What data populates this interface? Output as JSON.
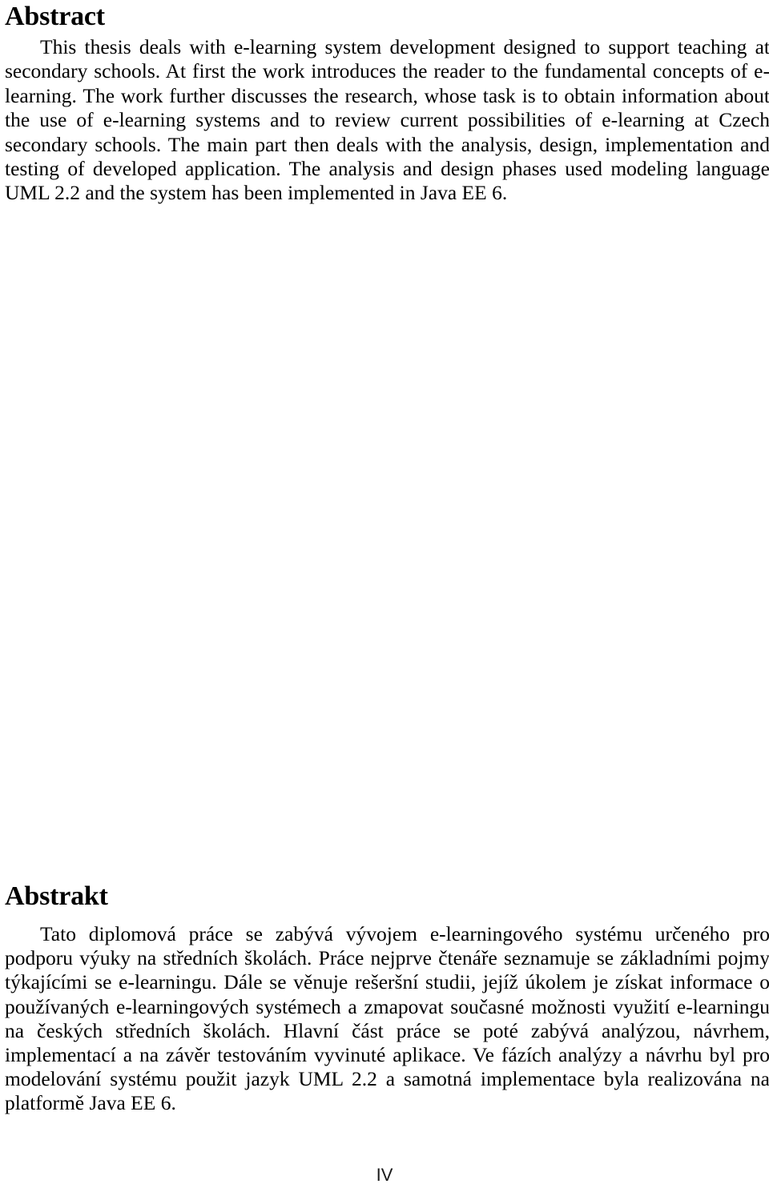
{
  "document": {
    "type": "thesis-abstract-page",
    "page_number": "IV",
    "background_color": "#ffffff",
    "text_color": "#000000"
  },
  "sections": {
    "abstract_en": {
      "heading": "Abstract",
      "body": "This thesis deals with e-learning system development designed to support teaching at secondary schools. At first the work introduces the reader to the fundamental concepts of e-learning. The work further discusses the research, whose task is to obtain information about the use of e-learning systems and to review current possibilities of e-learning at Czech secondary schools. The main part then deals with the analysis, design, implementation and testing of developed application. The analysis and design phases used modeling language UML 2.2 and the system has been implemented in Java EE 6."
    },
    "abstract_cs": {
      "heading": "Abstrakt",
      "body": "Tato diplomová práce se zabývá vývojem e-learningového systému určeného pro podporu výuky na středních školách. Práce nejprve čtenáře seznamuje se základními pojmy týkajícími se e-learningu. Dále se věnuje rešeršní studii, jejíž úkolem je získat informace o používaných e-learningových systémech a zmapovat současné možnosti využití e-learningu na českých středních školách. Hlavní část práce se poté zabývá analýzou, návrhem, implementací a na závěr testováním vyvinuté aplikace. Ve fázích analýzy a návrhu byl pro modelování systému použit jazyk UML 2.2 a samotná implementace byla realizována na platformě Java EE 6."
    }
  },
  "footer": {
    "page_label": "IV"
  }
}
